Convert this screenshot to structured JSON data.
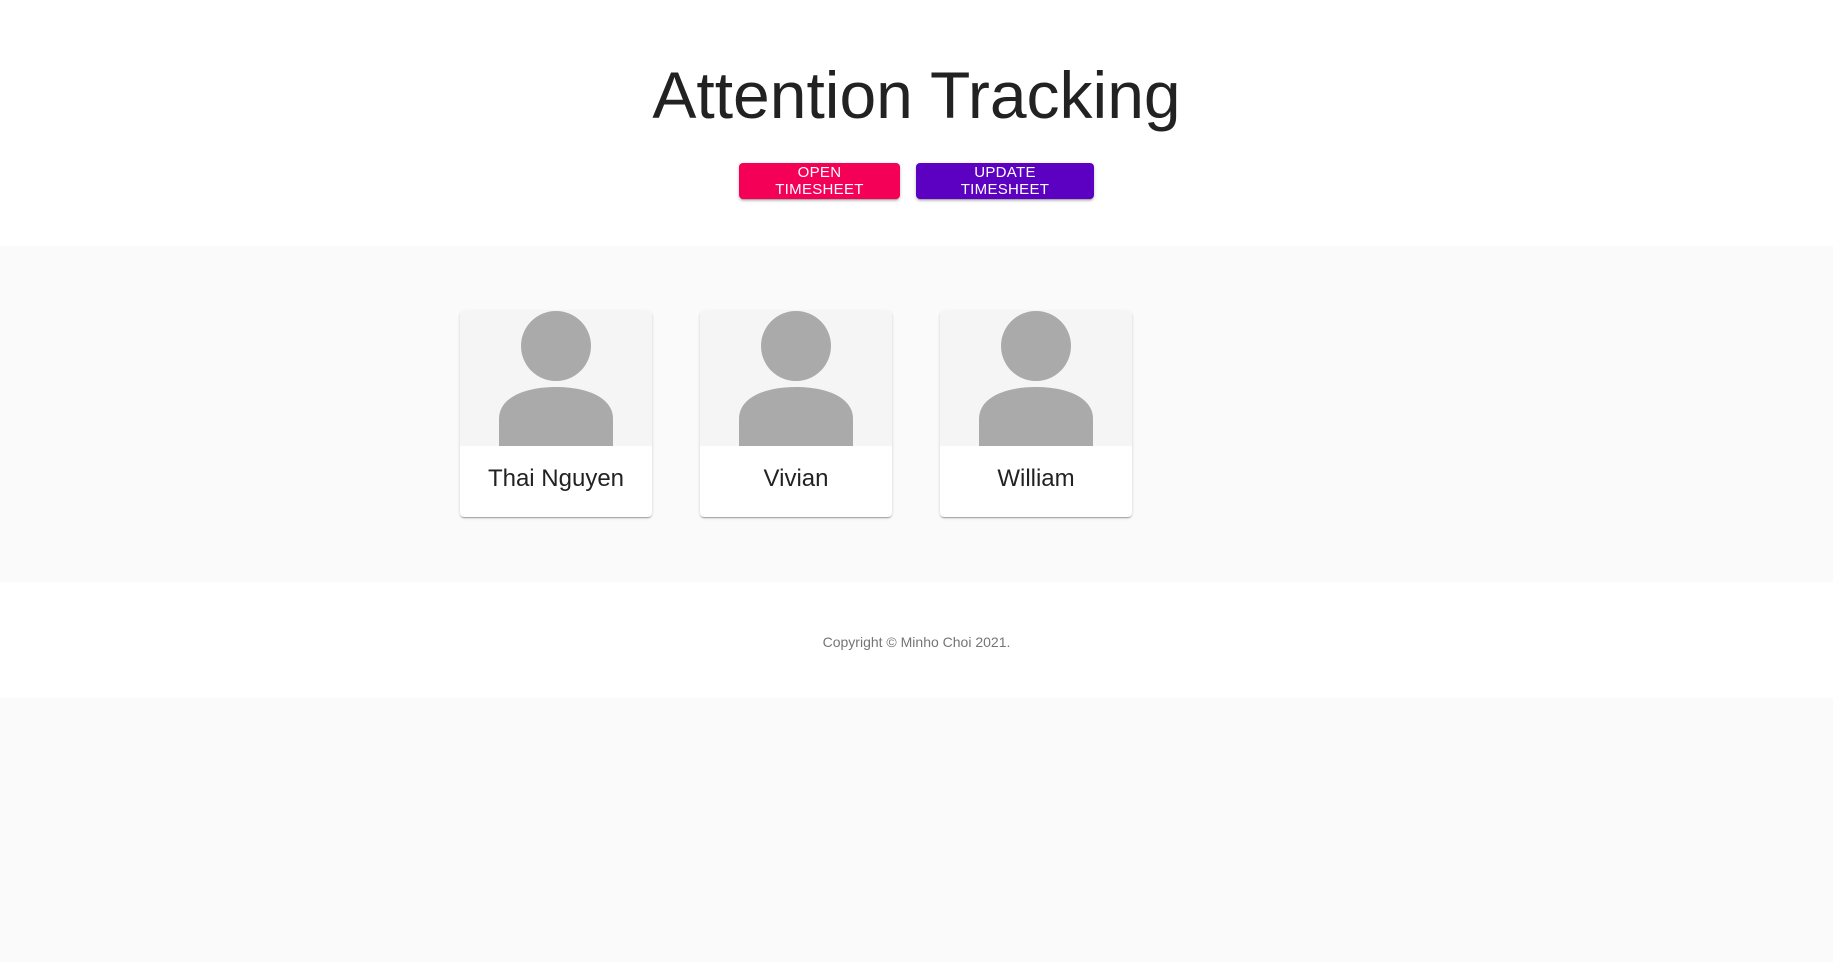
{
  "header": {
    "title": "Attention Tracking",
    "buttons": {
      "open_label": "OPEN TIMESHEET",
      "update_label": "UPDATE TIMESHEET"
    }
  },
  "people": [
    {
      "name": "Thai Nguyen",
      "avatar_icon": "person-placeholder-icon"
    },
    {
      "name": "Vivian",
      "avatar_icon": "person-placeholder-icon"
    },
    {
      "name": "William",
      "avatar_icon": "person-placeholder-icon"
    }
  ],
  "footer": {
    "copyright": "Copyright © Minho Choi 2021."
  },
  "colors": {
    "open_button": "#f50057",
    "update_button": "#5c00c2",
    "avatar": "#aaaaaa"
  }
}
